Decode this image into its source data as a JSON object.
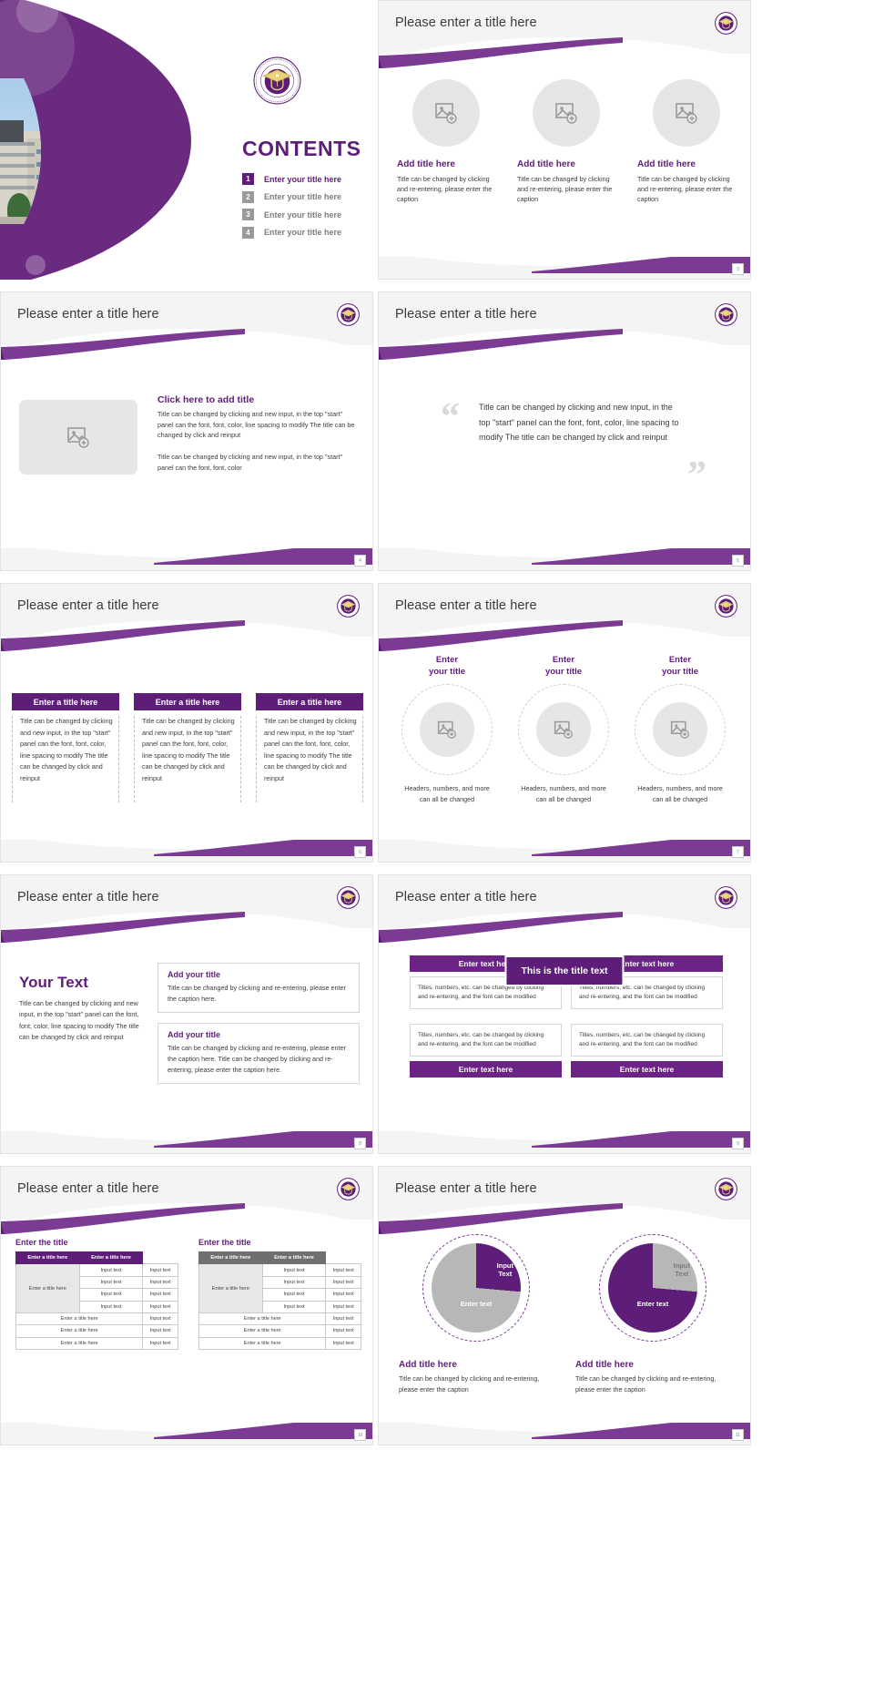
{
  "common": {
    "slide_title": "Please enter a title here",
    "emblem_name": "university-emblem"
  },
  "slide1": {
    "heading": "CONTENTS",
    "toc": [
      {
        "num": "1",
        "label": "Enter your title here"
      },
      {
        "num": "2",
        "label": "Enter your title here"
      },
      {
        "num": "3",
        "label": "Enter your title here"
      },
      {
        "num": "4",
        "label": "Enter your title here"
      }
    ]
  },
  "slide2": {
    "title": "Please enter a title here",
    "page": "3",
    "columns": [
      {
        "title": "Add title here",
        "body": "Title can be changed by clicking and re-entering, please enter the caption"
      },
      {
        "title": "Add title here",
        "body": "Title can be changed by clicking and re-entering, please enter the caption"
      },
      {
        "title": "Add title here",
        "body": "Title can be changed by clicking and re-entering, please enter the caption"
      }
    ]
  },
  "slide3": {
    "title": "Please enter a title here",
    "page": "4",
    "heading": "Click here to add title",
    "body1": "Title can be changed by clicking and new input, in the top \"start\" panel can the font, font, color, line spacing to modify The title can be changed by click and reinput",
    "body2": "Title can be changed by clicking and new input, in the top \"start\" panel can the font, font, color"
  },
  "slide4": {
    "title": "Please enter a title here",
    "page": "5",
    "quote": "Title can be changed by clicking and new input, in the top \"start\" panel can the font, font, color, line spacing to modify The title can be changed by click and reinput",
    "quote_open": "“",
    "quote_close": "”"
  },
  "slide5": {
    "title": "Please enter a title here",
    "page": "6",
    "columns": [
      {
        "head": "Enter a title here",
        "body": "Title can be changed by clicking and new input, in the top \"start\" panel can the font, font, color, line spacing to modify The title can be changed by click and reinput"
      },
      {
        "head": "Enter a title here",
        "body": "Title can be changed by clicking and new input, in the top \"start\" panel can the font, font, color, line spacing to modify The title can be changed by click and reinput"
      },
      {
        "head": "Enter a title here",
        "body": "Title can be changed by clicking and new input, in the top \"start\" panel can the font, font, color, line spacing to modify The title can be changed by click and reinput"
      }
    ]
  },
  "slide6": {
    "title": "Please enter a title here",
    "page": "7",
    "columns": [
      {
        "title": "Enter\nyour title",
        "body": "Headers, numbers, and more can all be changed"
      },
      {
        "title": "Enter\nyour title",
        "body": "Headers, numbers, and more can all be changed"
      },
      {
        "title": "Enter\nyour title",
        "body": "Headers, numbers, and more can all be changed"
      }
    ]
  },
  "slide7": {
    "title": "Please enter a title here",
    "page": "8",
    "heading": "Your Text",
    "lead": "Title can be changed by clicking and new input, in the top \"start\" panel can the font, font, color, line spacing to modify The title can be changed by click and reinput",
    "cards": [
      {
        "title": "Add your title",
        "body": "Title can be changed by clicking and re-entering, please enter the caption here."
      },
      {
        "title": "Add your title",
        "body": "Title can be changed by clicking and re-entering, please enter the caption here. Title can be changed by clicking and re-entering, please enter the caption here."
      }
    ]
  },
  "slide8": {
    "title": "Please enter a title here",
    "page": "9",
    "center_label": "This is the title text",
    "top_bars": [
      "Enter text here",
      "Enter text here"
    ],
    "top_cells": [
      "Titles, numbers, etc. can be changed by clicking and re-entering, and the font can be modified",
      "Titles, numbers, etc. can be changed by clicking and re-entering, and the font can be modified"
    ],
    "bottom_cells": [
      "Titles, numbers, etc. can be changed by clicking and re-entering, and the font can be modified",
      "Titles, numbers, etc. can be changed by clicking and re-entering, and the font can be modified"
    ],
    "bottom_bars": [
      "Enter text here",
      "Enter text here"
    ]
  },
  "slide9": {
    "title": "Please enter a title here",
    "page": "10",
    "tables": [
      {
        "caption": "Enter the title",
        "headers": [
          "Enter a title here",
          "Enter a title here"
        ],
        "side_label": "Enter a title here",
        "rows": [
          [
            "Input text",
            "Input text"
          ],
          [
            "Input text",
            "Input text"
          ],
          [
            "Input text",
            "Input text"
          ],
          [
            "Input text",
            "Input text"
          ]
        ],
        "footer_rows": [
          [
            "Enter a title here",
            "Input text"
          ],
          [
            "Enter a title here",
            "Input text"
          ],
          [
            "Enter a title here",
            "Input text"
          ]
        ]
      },
      {
        "caption": "Enter the title",
        "headers": [
          "Enter a title here",
          "Enter a title here"
        ],
        "side_label": "Enter a title here",
        "rows": [
          [
            "Input text",
            "Input text"
          ],
          [
            "Input text",
            "Input text"
          ],
          [
            "Input text",
            "Input text"
          ],
          [
            "Input text",
            "Input text"
          ]
        ],
        "footer_rows": [
          [
            "Enter a title here",
            "Input text"
          ],
          [
            "Enter a title here",
            "Input text"
          ],
          [
            "Enter a title here",
            "Input text"
          ]
        ]
      }
    ]
  },
  "slide10": {
    "title": "Please enter a title here",
    "page": "11",
    "columns": [
      {
        "inner_label": "Input\nText",
        "arc_label": "Enter text",
        "title": "Add title here",
        "body": "Title can be changed by clicking and re-entering, please enter the caption"
      },
      {
        "inner_label": "Input\nText",
        "arc_label": "Enter text",
        "title": "Add title here",
        "body": "Title can be changed by clicking and re-entering, please enter the caption"
      }
    ]
  },
  "colors": {
    "brand_purple": "#5f1d7a",
    "brand_purple_light": "#7b3b93",
    "header_grey": "#f4f4f4",
    "placeholder_grey": "#e6e6e6",
    "body_text": "#3c3c3c"
  }
}
